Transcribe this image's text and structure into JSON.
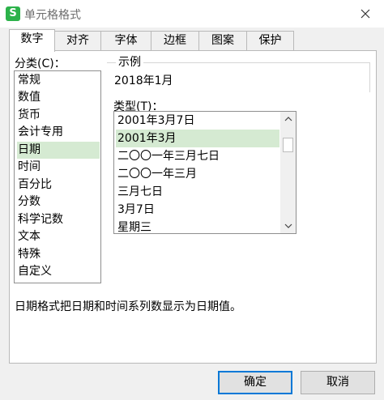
{
  "window": {
    "logo_text": "S",
    "title": "单元格格式"
  },
  "tabs": [
    {
      "label": "数字",
      "active": true
    },
    {
      "label": "对齐"
    },
    {
      "label": "字体"
    },
    {
      "label": "边框"
    },
    {
      "label": "图案"
    },
    {
      "label": "保护"
    }
  ],
  "category": {
    "label": "分类(C)：",
    "items": [
      "常规",
      "数值",
      "货币",
      "会计专用",
      "日期",
      "时间",
      "百分比",
      "分数",
      "科学记数",
      "文本",
      "特殊",
      "自定义"
    ],
    "selected": "日期"
  },
  "sample": {
    "label": "示例",
    "value": "2018年1月"
  },
  "type": {
    "label": "类型(T)：",
    "items": [
      "2001年3月7日",
      "2001年3月",
      "二〇〇一年三月七日",
      "二〇〇一年三月",
      "三月七日",
      "3月7日",
      "星期三"
    ],
    "selected": "2001年3月"
  },
  "description": "日期格式把日期和时间系列数显示为日期值。",
  "buttons": {
    "ok": "确定",
    "cancel": "取消"
  },
  "icons": {
    "close": "close-icon",
    "scroll_up": "chevron-up-icon",
    "scroll_down": "chevron-down-icon"
  },
  "colors": {
    "selection": "#d5ead2",
    "logo": "#2cb24a",
    "default_button_border": "#0078d7"
  }
}
